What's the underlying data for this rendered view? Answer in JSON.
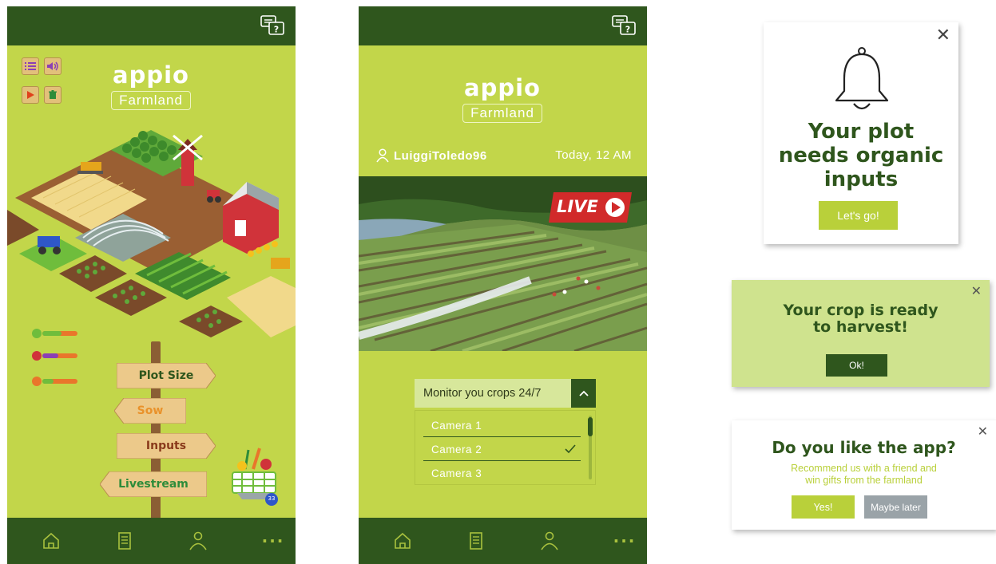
{
  "brand": {
    "logo_word": "appio",
    "logo_sub": "Farmland"
  },
  "colors": {
    "dark_green": "#2f561d",
    "lime": "#c2d64a",
    "button": "#b9d03a",
    "light_panel": "#cfe38e"
  },
  "screen1": {
    "signs": {
      "plot_size": "Plot Size",
      "sow": "Sow",
      "inputs": "Inputs",
      "livestream": "Livestream"
    },
    "basket_count": "33",
    "tools": [
      "list-icon",
      "volume-icon",
      "play-icon",
      "trash-icon"
    ]
  },
  "screen2": {
    "username": "LuiggiToledo96",
    "timestamp": "Today, 12 AM",
    "live_label": "LIVE",
    "dropdown": {
      "label": "Monitor you crops 24/7",
      "items": [
        {
          "label": "Camera 1",
          "selected": false
        },
        {
          "label": "Camera 2",
          "selected": true
        },
        {
          "label": "Camera 3",
          "selected": false
        }
      ]
    }
  },
  "nav": [
    "home-icon",
    "document-icon",
    "profile-icon",
    "more-icon"
  ],
  "popups": {
    "organic": {
      "title": "Your plot needs organic inputs",
      "button": "Let's go!"
    },
    "harvest": {
      "title_line1": "Your crop is ready",
      "title_line2": "to harvest!",
      "button": "Ok!"
    },
    "rate": {
      "title": "Do you like the app?",
      "body_line1": "Recommend us with a friend and",
      "body_line2": "win gifts from the farmland",
      "yes": "Yes!",
      "later": "Maybe later"
    }
  }
}
